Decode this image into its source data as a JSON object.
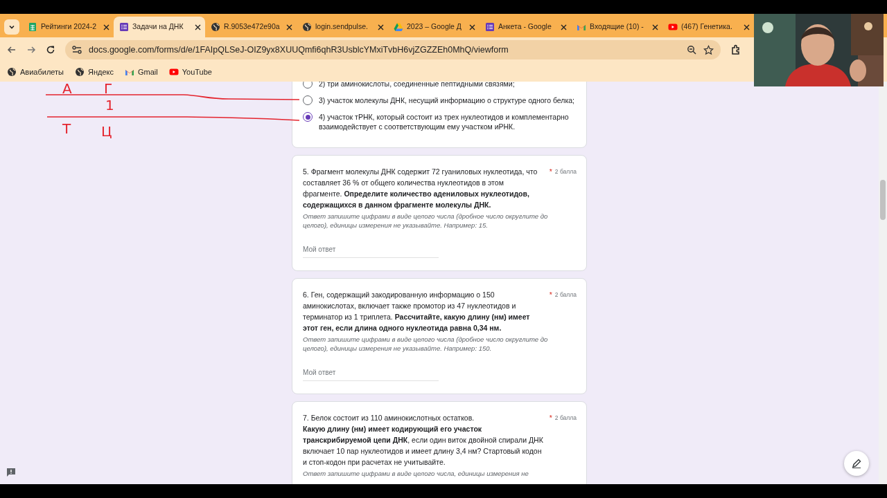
{
  "tabs": [
    {
      "kind": "sheets",
      "title": "Рейтинги 2024-2",
      "selected": false
    },
    {
      "kind": "forms",
      "title": "Задачи на ДНК",
      "selected": true
    },
    {
      "kind": "globe",
      "title": "R.9053e472e90a",
      "selected": false
    },
    {
      "kind": "globe",
      "title": "login.sendpulse.",
      "selected": false
    },
    {
      "kind": "drive",
      "title": "2023 – Google Д",
      "selected": false
    },
    {
      "kind": "forms",
      "title": "Анкета - Google",
      "selected": false
    },
    {
      "kind": "gmail",
      "title": "Входящие (10) -",
      "selected": false
    },
    {
      "kind": "youtube",
      "title": "(467) Генетика.",
      "selected": false
    }
  ],
  "address_bar": {
    "url": "docs.google.com/forms/d/e/1FAIpQLSeJ-OIZ9yx8XUUQmfi6qhR3UsblcYMxiTvbH6vjZGZZEh0MhQ/viewform"
  },
  "bookmarks": [
    {
      "kind": "globe",
      "label": "Авиабилеты"
    },
    {
      "kind": "globe",
      "label": "Яндекс"
    },
    {
      "kind": "gmail",
      "label": "Gmail"
    },
    {
      "kind": "youtube",
      "label": "YouTube"
    }
  ],
  "annotation": {
    "letters": [
      "А",
      "Г",
      "1",
      "Т",
      "Ц"
    ]
  },
  "options": [
    {
      "label": "2) три аминокислоты, соединенные пептидными связями;",
      "selected": false
    },
    {
      "label": "3) участок молекулы ДНК, несущий информацию о структуре одного белка;",
      "selected": false
    },
    {
      "label": "4) участок тРНК, который состоит из трех нуклеотидов и комплементарно взаимодействует с соответствующим ему участком иРНК.",
      "selected": true
    }
  ],
  "questions": [
    {
      "text": "5. Фрагмент молекулы ДНК содержит 72 гуаниловых нуклеотида, что составляет 36 % от общего количества нуклеотидов в этом фрагменте. **Определите количество адениловых нуклеотидов, содержащихся в данном фрагменте молекулы ДНК.**",
      "required": "*",
      "points": "2 балла",
      "hint": "Ответ запишите цифрами в виде целого числа (дробное число округлите до целого), единицы измерения не указывайте. Например: 15.",
      "placeholder": "Мой ответ"
    },
    {
      "text": "6. Ген, содержащий закодированную информацию о 150 аминокислотах, включает также промотор из 47 нуклеотидов и терминатор из 1 триплета. **Рассчитайте, какую длину (нм) имеет этот ген, если длина одного нуклеотида равна 0,34 нм.**",
      "required": "*",
      "points": "2 балла",
      "hint": "Ответ запишите цифрами в виде целого числа (дробное число округлите до целого), единицы измерения не указывайте. Например: 150.",
      "placeholder": "Мой ответ"
    },
    {
      "text": "7. Белок состоит из 110 аминокислотных остатков.\n**Какую длину (нм) имеет кодирующий его участок транскрибируемой цепи ДНК**, если один виток двойной спирали ДНК включает 10 пар нуклеотидов и имеет длину 3,4 нм? Стартовый кодон и стоп-кодон при расчетах не учитывайте.",
      "required": "*",
      "points": "2 балла",
      "hint": "Ответ запишите цифрами в виде целого числа, единицы измерения не"
    }
  ]
}
